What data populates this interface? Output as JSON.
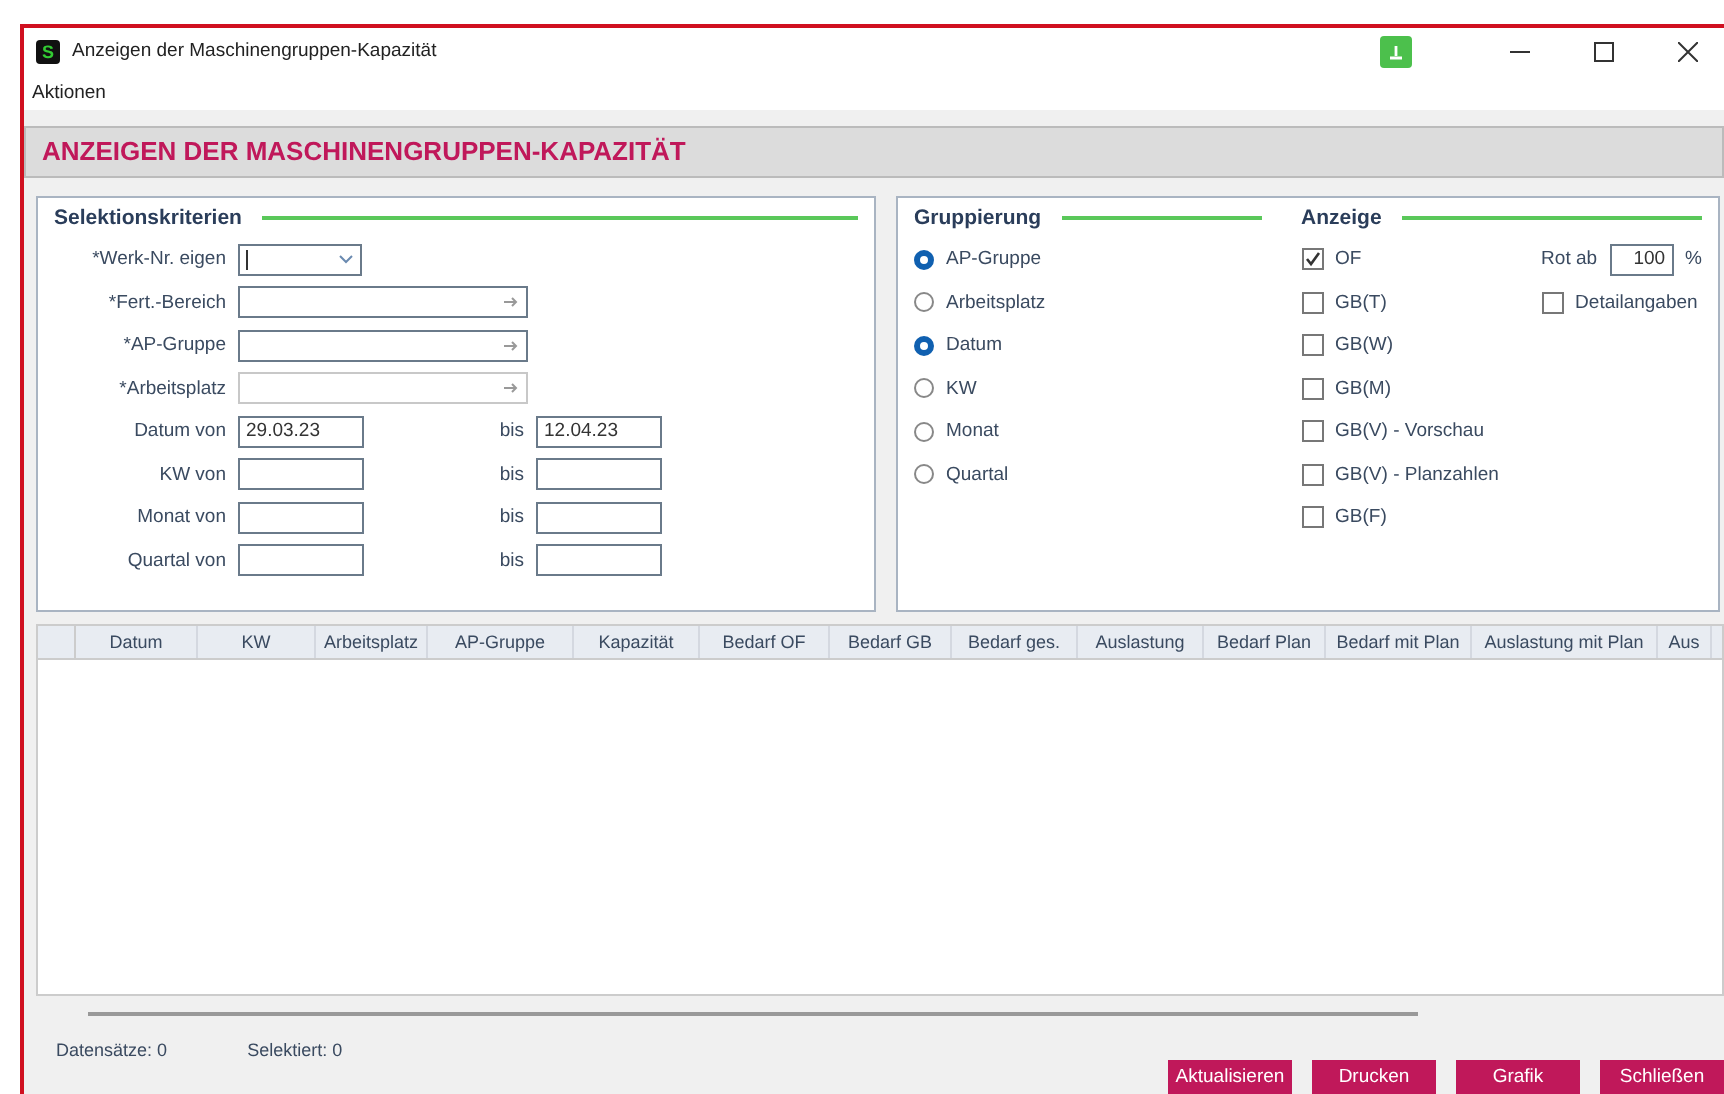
{
  "window": {
    "title": "Anzeigen der Maschinengruppen-Kapazität",
    "app_icon_text": "S"
  },
  "menu": [
    "Aktionen"
  ],
  "header": "ANZEIGEN DER MASCHINENGRUPPEN-KAPAZITÄT",
  "selection": {
    "title": "Selektionskriterien",
    "fields": [
      {
        "label": "*Werk-Nr. eigen",
        "kind": "dropdown",
        "disabled": false
      },
      {
        "label": "*Fert.-Bereich",
        "kind": "lookup",
        "disabled": false
      },
      {
        "label": "*AP-Gruppe",
        "kind": "lookup",
        "disabled": false
      },
      {
        "label": "*Arbeitsplatz",
        "kind": "lookup",
        "disabled": true
      },
      {
        "label": "Datum von",
        "kind": "range",
        "value": "29.03.23",
        "to_label": "bis",
        "to_value": "12.04.23"
      },
      {
        "label": "KW von",
        "kind": "range",
        "to_label": "bis"
      },
      {
        "label": "Monat von",
        "kind": "range",
        "to_label": "bis"
      },
      {
        "label": "Quartal von",
        "kind": "range",
        "to_label": "bis"
      }
    ]
  },
  "grouping": {
    "title": "Gruppierung",
    "options": [
      {
        "label": "AP-Gruppe",
        "selected": true
      },
      {
        "label": "Arbeitsplatz",
        "selected": false
      },
      {
        "label": "Datum",
        "selected": true
      },
      {
        "label": "KW",
        "selected": false
      },
      {
        "label": "Monat",
        "selected": false
      },
      {
        "label": "Quartal",
        "selected": false
      }
    ]
  },
  "display": {
    "title": "Anzeige",
    "options": [
      {
        "label": "OF",
        "checked": true
      },
      {
        "label": "GB(T)",
        "checked": false
      },
      {
        "label": "GB(W)",
        "checked": false
      },
      {
        "label": "GB(M)",
        "checked": false
      },
      {
        "label": "GB(V) - Vorschau",
        "checked": false
      },
      {
        "label": "GB(V) - Planzahlen",
        "checked": false
      },
      {
        "label": "GB(F)",
        "checked": false
      }
    ],
    "red_from": {
      "label": "Rot ab",
      "value": "100",
      "unit": "%"
    },
    "details": {
      "label": "Detailangaben",
      "checked": false
    }
  },
  "table": {
    "columns": [
      "Datum",
      "KW",
      "Arbeitsplatz",
      "AP-Gruppe",
      "Kapazität",
      "Bedarf OF",
      "Bedarf GB",
      "Bedarf ges.",
      "Auslastung",
      "Bedarf Plan",
      "Bedarf mit Plan",
      "Auslastung mit Plan",
      "Aus"
    ]
  },
  "status_bar": [
    {
      "label": "Datensätze:",
      "value": "0"
    },
    {
      "label": "Selektiert:",
      "value": "0"
    }
  ],
  "buttons": [
    "Aktualisieren",
    "Drucken",
    "Grafik",
    "Schließen"
  ]
}
